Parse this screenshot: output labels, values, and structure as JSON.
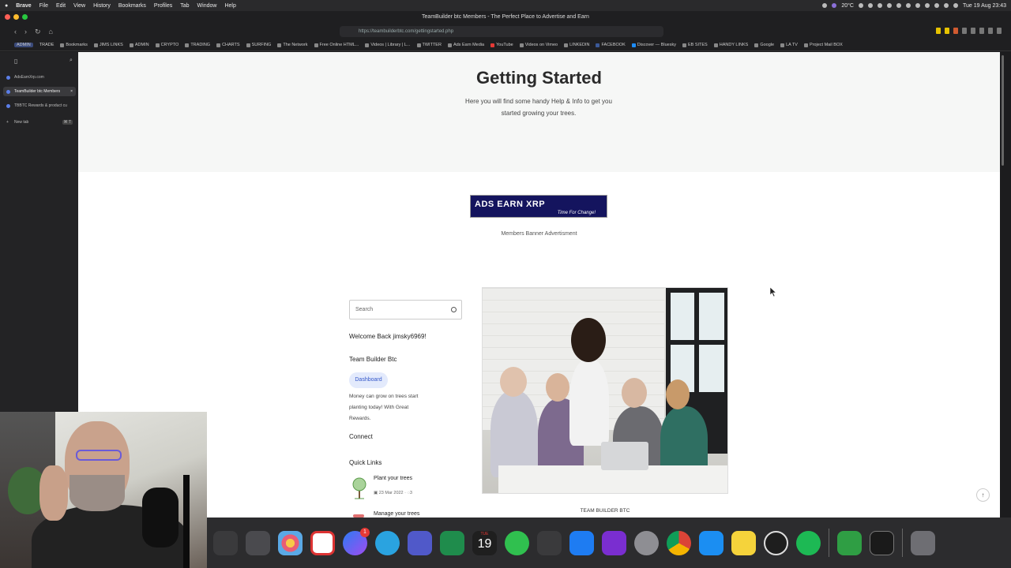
{
  "menubar": {
    "app": "Brave",
    "items": [
      "File",
      "Edit",
      "View",
      "History",
      "Bookmarks",
      "Profiles",
      "Tab",
      "Window",
      "Help"
    ],
    "temperature": "20°C",
    "clock": "Tue 19 Aug 23:43"
  },
  "window": {
    "title": "TeamBuilder btc Members - The Perfect Place to Advertise and Earn"
  },
  "browser": {
    "url": "https://teambuilderbtc.com/gettingstarted.php",
    "bookmarks": [
      "Bookmarks",
      "JIMS LINKS",
      "ADMIN",
      "CRYPTO",
      "TRADING",
      "CHARTS",
      "SURFING",
      "The Network",
      "Free Online HTML...",
      "Videos | Library | L...",
      "TWITTER",
      "Ads Earn Media",
      "YouTube",
      "Videos on Vimeo",
      "LINKEDIN",
      "FACEBOOK",
      "Discover — Bluesky",
      "EB SITES",
      "HANDY LINKS",
      "Google",
      "LA TV",
      "Project Mail BOX"
    ],
    "workspace_labels": [
      "ADMIN",
      "TRADE"
    ]
  },
  "sidebar": {
    "tabs": [
      {
        "label": "AdsEarnXrp.com",
        "active": false
      },
      {
        "label": "TeamBuilder btc Members",
        "active": true
      },
      {
        "label": "TBBTC Rewards & product cu",
        "active": false
      }
    ],
    "new_tab": "New tab",
    "new_tab_shortcut": "⌘ T"
  },
  "page": {
    "hero": {
      "title": "Getting Started",
      "subtitle": "Here you will find some handy Help & Info to get you started growing your trees."
    },
    "banner": {
      "headline": "ADS EARN  XRP",
      "tagline": "Time For Change!",
      "caption": "Members Banner Advertisment"
    },
    "search": {
      "placeholder": "Search"
    },
    "welcome": "Welcome Back jimsky6969!",
    "team_title": "Team Builder Btc",
    "dashboard_button": "Dashboard",
    "blurb": "Money can grow on trees start planting today! With Great Rewards.",
    "connect": "Connect",
    "quick_links": {
      "heading": "Quick Links",
      "items": [
        {
          "title": "Plant your trees",
          "date": "23 Mar 2022",
          "comments": "3"
        },
        {
          "title": "Manage your trees"
        }
      ]
    },
    "photo_caption": "TEAM BUILDER BTC"
  },
  "dock": {
    "calendar_day": "19",
    "calendar_month": "TUE",
    "messenger_badge": "1"
  },
  "colors": {
    "accent": "#3457c9",
    "banner_bg": "#14145e",
    "hero_bg": "#f6f7f6"
  }
}
